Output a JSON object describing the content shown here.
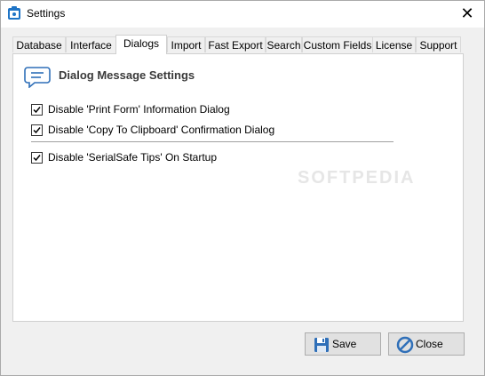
{
  "window": {
    "title": "Settings",
    "close_glyph": "✕"
  },
  "tabs": [
    {
      "label": "Database"
    },
    {
      "label": "Interface"
    },
    {
      "label": "Dialogs",
      "active": true
    },
    {
      "label": "Import"
    },
    {
      "label": "Fast Export"
    },
    {
      "label": "Search"
    },
    {
      "label": "Custom Fields"
    },
    {
      "label": "License"
    },
    {
      "label": "Support"
    }
  ],
  "panel": {
    "section_title": "Dialog Message Settings",
    "section_icon": "speech-bubble-icon",
    "checkboxes": [
      {
        "label": "Disable 'Print Form' Information Dialog",
        "checked": true
      },
      {
        "label": "Disable 'Copy To Clipboard' Confirmation Dialog",
        "checked": true
      },
      {
        "label": "Disable 'SerialSafe Tips' On Startup",
        "checked": true
      }
    ]
  },
  "buttons": {
    "save": {
      "label": "Save",
      "icon": "floppy-disk-icon"
    },
    "close": {
      "label": "Close",
      "icon": "prohibited-icon"
    }
  },
  "watermark": "SOFTPEDIA",
  "colors": {
    "accent": "#1e74c6",
    "icon_blue": "#2f6fb8"
  }
}
